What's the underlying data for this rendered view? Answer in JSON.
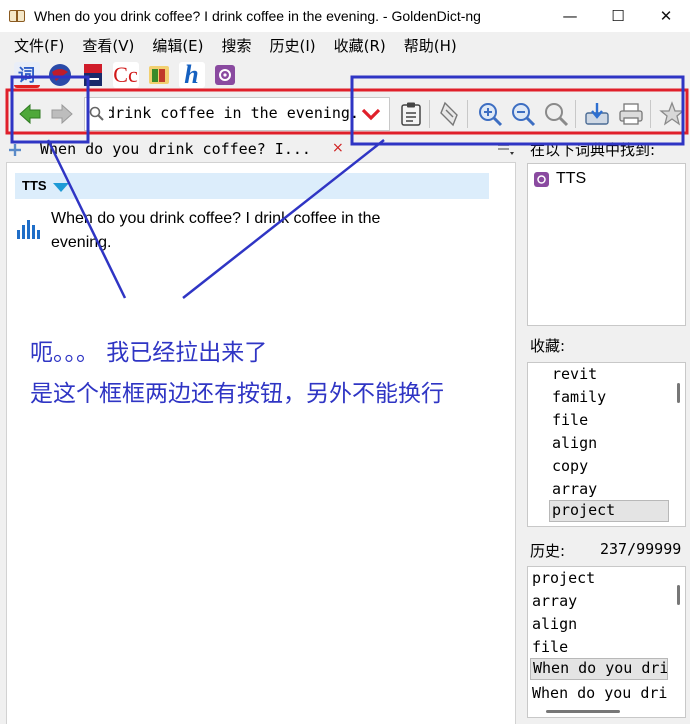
{
  "window": {
    "title": "When do you drink coffee? I drink coffee in the evening. - GoldenDict-ng",
    "minimize": "—",
    "maximize": "☐",
    "close": "✕"
  },
  "menu": [
    "文件(F)",
    "查看(V)",
    "编辑(E)",
    "搜索",
    "历史(I)",
    "收藏(R)",
    "帮助(H)"
  ],
  "dictionaries": [
    {
      "name": "dict-ci-icon",
      "glyph": "词",
      "bg": "#e9eef8",
      "fg": "#2f5fc8"
    },
    {
      "name": "dict-globe-icon",
      "glyph": "",
      "bg": "#2a4aa8",
      "fg": "#ffffff"
    },
    {
      "name": "dict-book-red-icon",
      "glyph": "",
      "bg": "#1a2a6a",
      "fg": "#ffffff"
    },
    {
      "name": "dict-cc-icon",
      "glyph": "Cc",
      "bg": "#ffffff",
      "fg": "#d01818"
    },
    {
      "name": "dict-books-icon",
      "glyph": "",
      "bg": "#f2d070",
      "fg": "#3a8a2a"
    },
    {
      "name": "dict-h-icon",
      "glyph": "h",
      "bg": "#ffffff",
      "fg": "#1560c0"
    },
    {
      "name": "dict-tts-icon",
      "glyph": "",
      "bg": "#8a4aa0",
      "fg": "#ffffff"
    }
  ],
  "translate_line": {
    "value": "When do you drink coffee? I drink coffee in the evening."
  },
  "tab": {
    "label": "When do you drink coffee? I...",
    "close": "×"
  },
  "article": {
    "dict_header": "TTS",
    "text": "When do you drink coffee? I drink coffee in the evening."
  },
  "annotation": {
    "line1": "呃。。。 我已经拉出来了",
    "line2": "是这个框框两边还有按钮，另外不能换行"
  },
  "found_in": {
    "label": "在以下词典中找到:",
    "items": [
      "TTS"
    ]
  },
  "favorites": {
    "label": "收藏:",
    "items": [
      "revit",
      "family",
      "file",
      "align",
      "copy",
      "array",
      "project"
    ],
    "selected": "project"
  },
  "history": {
    "label": "历史:",
    "count": "237/99999",
    "items": [
      "project",
      "array",
      "align",
      "file",
      "When do you drink coffee?",
      "When do you drink coffee?"
    ],
    "selected": 4
  },
  "colors": {
    "accent_red": "#e0202a",
    "accent_blue": "#2f35c4",
    "nav_green": "#4fa83a"
  }
}
